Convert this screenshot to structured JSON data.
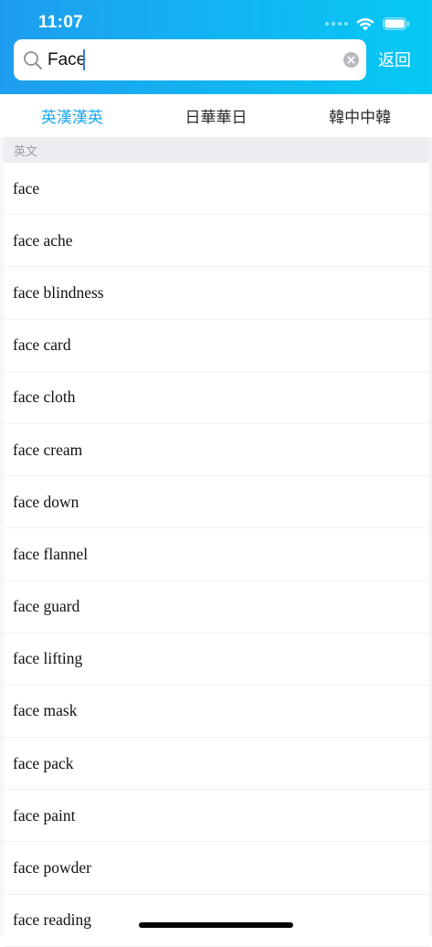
{
  "status_bar": {
    "time": "11:07"
  },
  "search": {
    "value": "Face",
    "placeholder": ""
  },
  "header": {
    "back_label": "返回"
  },
  "tabs": [
    {
      "label": "英漢漢英",
      "active": true
    },
    {
      "label": "日華華日",
      "active": false
    },
    {
      "label": "韓中中韓",
      "active": false
    }
  ],
  "section": {
    "label": "英文"
  },
  "results": [
    "face",
    "face ache",
    "face blindness",
    "face card",
    "face cloth",
    "face cream",
    "face down",
    "face flannel",
    "face guard",
    "face lifting",
    "face mask",
    "face pack",
    "face paint",
    "face powder",
    "face reading"
  ],
  "colors": {
    "header_start": "#1e9df0",
    "header_end": "#06c9f5",
    "active_tab": "#1aa7ec",
    "caret": "#3478f6"
  },
  "icons": {
    "search": "search-icon",
    "clear": "clear-icon",
    "wifi": "wifi-icon",
    "battery": "battery-icon"
  }
}
